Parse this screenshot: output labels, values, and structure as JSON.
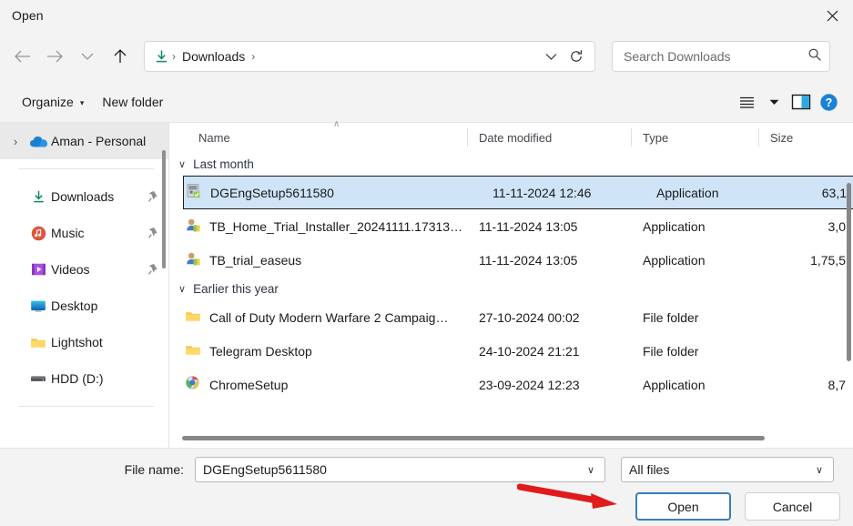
{
  "window": {
    "title": "Open",
    "close_label": "close-icon"
  },
  "nav": {
    "back": "back-arrow",
    "forward": "forward-arrow",
    "recent": "recent-chevron",
    "up": "up-arrow",
    "address": {
      "folder_icon": "downloads-icon",
      "crumbs": [
        "Downloads"
      ],
      "separator": "›",
      "dropdown": "chevron-down-icon",
      "refresh": "refresh-icon"
    },
    "search": {
      "placeholder": "Search Downloads",
      "icon": "search-icon"
    }
  },
  "commandbar": {
    "organize": "Organize",
    "organize_caret": "▾",
    "new_folder": "New folder",
    "view_icon": "view-list-icon",
    "view_caret": "▾",
    "preview_icon": "preview-pane-icon",
    "help_icon": "help-icon"
  },
  "sidebar": {
    "cloud_account": {
      "label": "Aman - Personal",
      "icon": "onedrive-icon",
      "expand": "›",
      "selected": true
    },
    "items": [
      {
        "label": "Downloads",
        "icon": "downloads-icon",
        "pinned": true
      },
      {
        "label": "Music",
        "icon": "music-icon",
        "pinned": true
      },
      {
        "label": "Videos",
        "icon": "videos-icon",
        "pinned": true
      },
      {
        "label": "Desktop",
        "icon": "desktop-icon",
        "pinned": false
      },
      {
        "label": "Lightshot",
        "icon": "folder-icon",
        "pinned": false
      },
      {
        "label": "HDD (D:)",
        "icon": "drive-icon",
        "pinned": false
      }
    ]
  },
  "filelist": {
    "columns": {
      "name": "Name",
      "date_modified": "Date modified",
      "type": "Type",
      "size": "Size",
      "sort_indicator": "∧"
    },
    "groups": [
      {
        "label": "Last month",
        "chevron": "∨",
        "rows": [
          {
            "name": "DGEngSetup5611580",
            "date": "11-11-2024 12:46",
            "type": "Application",
            "size": "63,1",
            "icon": "msi-installer-icon",
            "selected": true
          },
          {
            "name": "TB_Home_Trial_Installer_20241111.17313…",
            "date": "11-11-2024 13:05",
            "type": "Application",
            "size": "3,0",
            "icon": "setup-shield-icon",
            "selected": false
          },
          {
            "name": "TB_trial_easeus",
            "date": "11-11-2024 13:05",
            "type": "Application",
            "size": "1,75,5",
            "icon": "setup-shield-icon",
            "selected": false
          }
        ]
      },
      {
        "label": "Earlier this year",
        "chevron": "∨",
        "rows": [
          {
            "name": "Call of Duty Modern Warfare 2 Campaig…",
            "date": "27-10-2024 00:02",
            "type": "File folder",
            "size": "",
            "icon": "folder-icon",
            "selected": false
          },
          {
            "name": "Telegram Desktop",
            "date": "24-10-2024 21:21",
            "type": "File folder",
            "size": "",
            "icon": "folder-icon",
            "selected": false
          },
          {
            "name": "ChromeSetup",
            "date": "23-09-2024 12:23",
            "type": "Application",
            "size": "8,7",
            "icon": "chrome-setup-icon",
            "selected": false
          }
        ]
      }
    ]
  },
  "footer": {
    "filename_label": "File name:",
    "filename_value": "DGEngSetup5611580",
    "filename_caret": "∨",
    "filter_value": "All files",
    "filter_caret": "∨",
    "open_button": "Open",
    "cancel_button": "Cancel"
  },
  "annotation": {
    "arrow": "red-arrow-pointing-to-open-button",
    "color": "#e01b1b"
  }
}
